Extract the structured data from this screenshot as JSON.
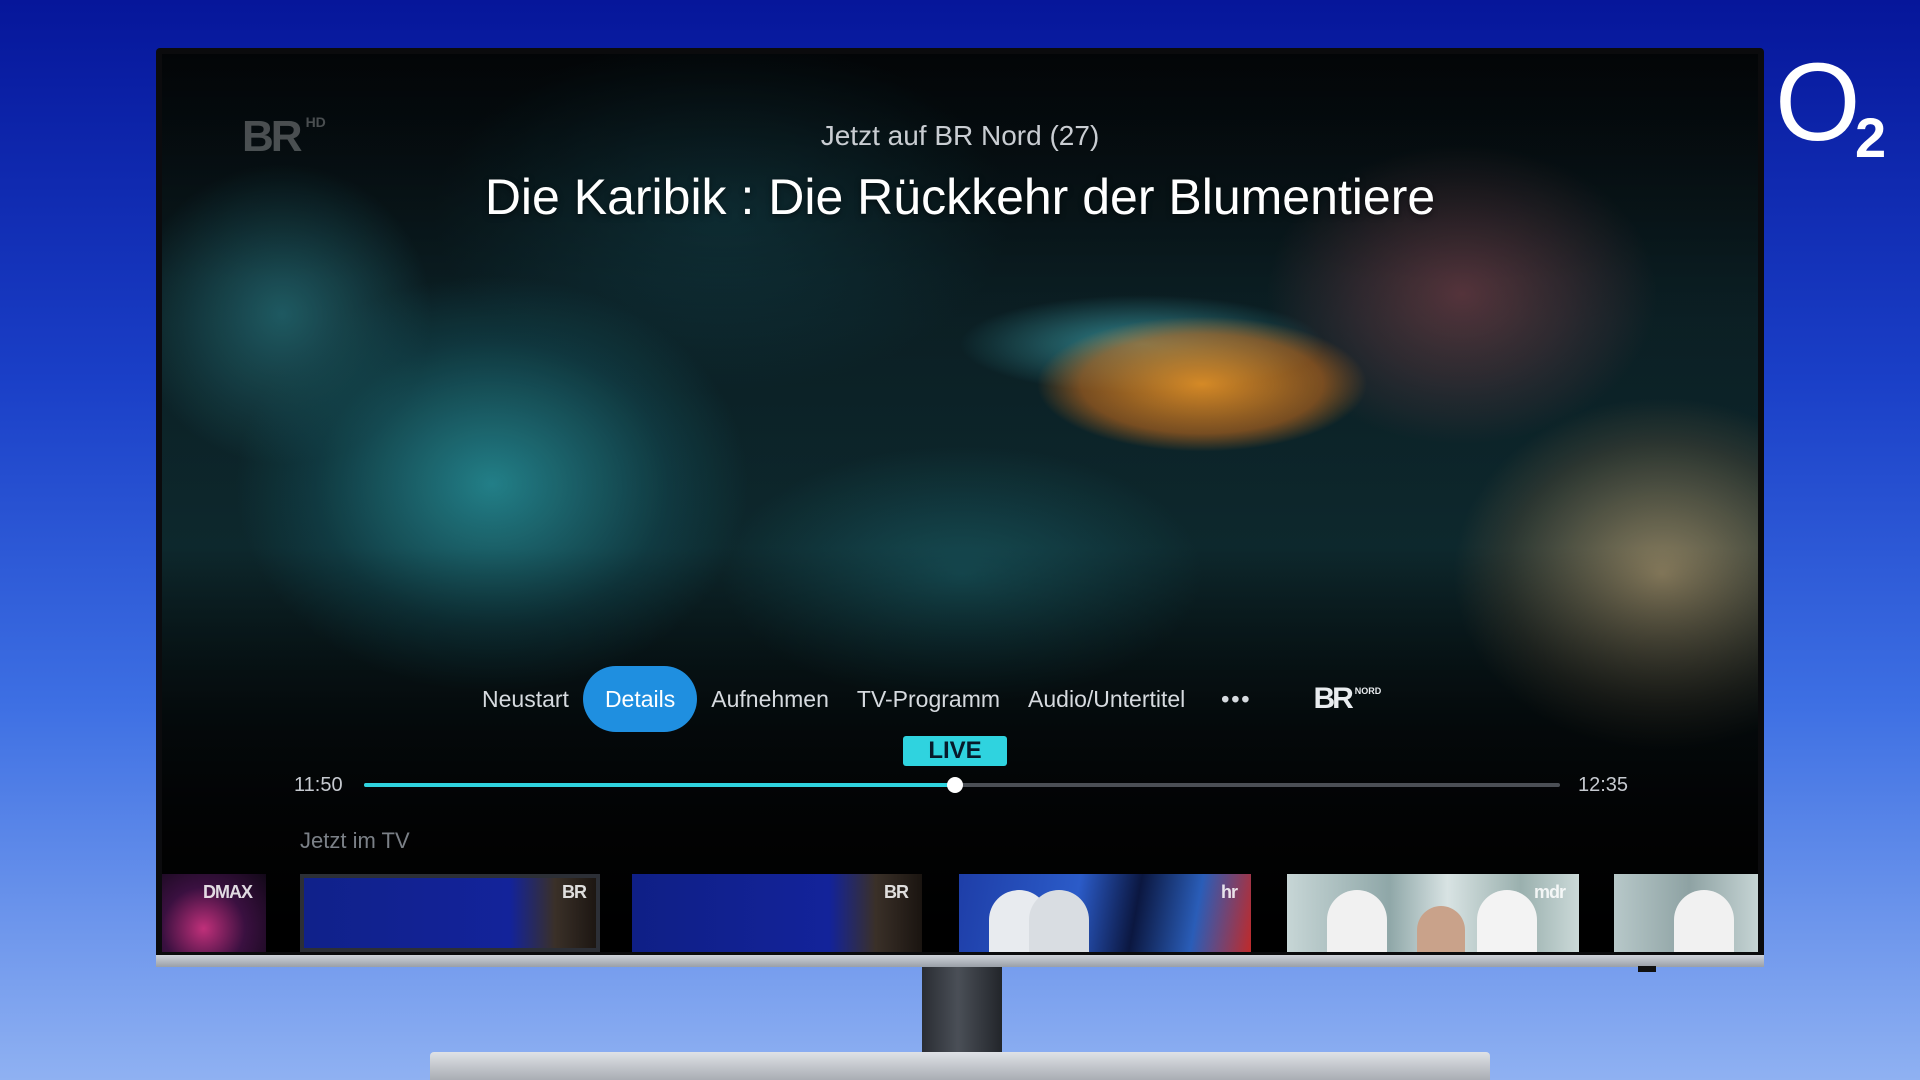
{
  "brand": {
    "o": "O",
    "two": "2"
  },
  "screen": {
    "channel_watermark": "BR",
    "channel_watermark_suffix": "HD",
    "now_label": "Jetzt auf BR Nord (27)",
    "show_title": "Die Karibik : Die Rückkehr der Blumentiere"
  },
  "menu": {
    "items": [
      {
        "label": "Neustart"
      },
      {
        "label": "Details",
        "active": true
      },
      {
        "label": "Aufnehmen"
      },
      {
        "label": "TV-Programm"
      },
      {
        "label": "Audio/Untertitel"
      },
      {
        "label": "•••"
      }
    ],
    "channel_logo": "BR",
    "channel_logo_suffix": "NORD"
  },
  "playback": {
    "live_label": "LIVE",
    "start_time": "11:50",
    "end_time": "12:35",
    "progress_fraction": 0.494
  },
  "jetzt_im_tv": {
    "heading": "Jetzt im TV",
    "thumbnails": [
      {
        "logo": "DMAX"
      },
      {
        "logo": "BR"
      },
      {
        "logo": "BR"
      },
      {
        "logo": "hr"
      },
      {
        "logo": "mdr"
      },
      {
        "logo": ""
      }
    ]
  },
  "colors": {
    "accent_blue": "#1f8fe0",
    "live_cyan": "#2fd3df"
  }
}
